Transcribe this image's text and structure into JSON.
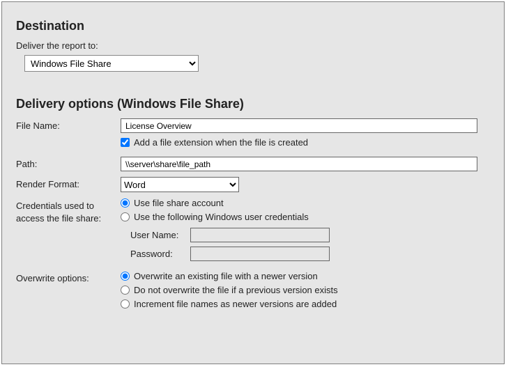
{
  "destination": {
    "heading": "Destination",
    "deliver_label": "Deliver the report to:",
    "deliver_value": "Windows File Share"
  },
  "delivery": {
    "heading": "Delivery options (Windows File Share)",
    "file_name_label": "File Name:",
    "file_name_value": "License Overview",
    "add_ext_label": "Add a file extension when the file is created",
    "add_ext_checked": true,
    "path_label": "Path:",
    "path_value": "\\\\server\\share\\file_path",
    "render_format_label": "Render Format:",
    "render_format_value": "Word",
    "credentials_label": "Credentials used to access the file share:",
    "cred_radio1": "Use file share account",
    "cred_radio2": "Use the following Windows user credentials",
    "cred_selected": "share",
    "username_label": "User Name:",
    "username_value": "",
    "password_label": "Password:",
    "password_value": "",
    "overwrite_label": "Overwrite options:",
    "overwrite_radio1": "Overwrite an existing file with a newer version",
    "overwrite_radio2": "Do not overwrite the file if a previous version exists",
    "overwrite_radio3": "Increment file names as newer versions are added",
    "overwrite_selected": "overwrite"
  }
}
